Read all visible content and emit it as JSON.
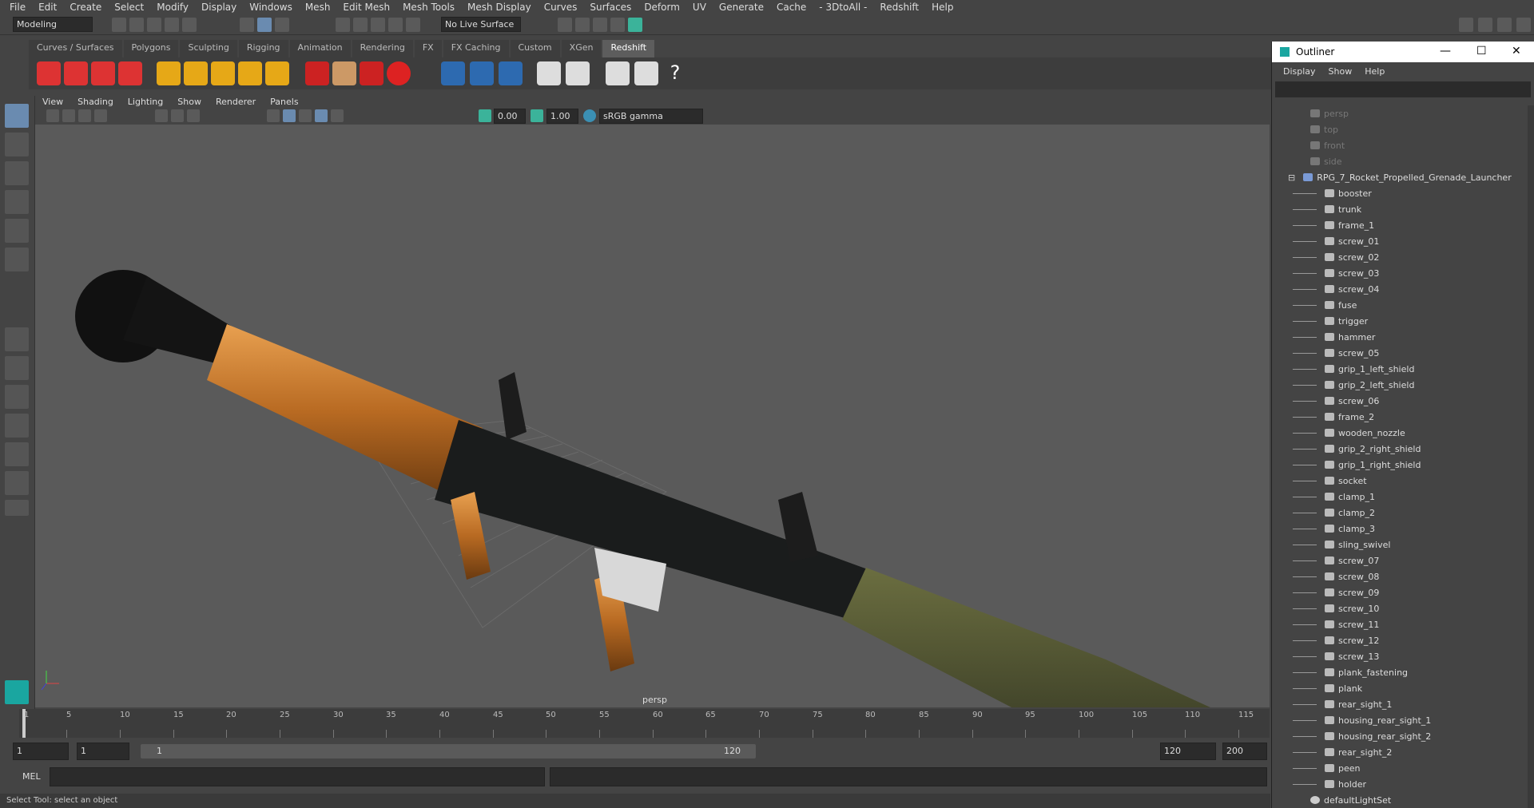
{
  "menubar": [
    "File",
    "Edit",
    "Create",
    "Select",
    "Modify",
    "Display",
    "Windows",
    "Mesh",
    "Edit Mesh",
    "Mesh Tools",
    "Mesh Display",
    "Curves",
    "Surfaces",
    "Deform",
    "UV",
    "Generate",
    "Cache",
    "- 3DtoAll -",
    "Redshift",
    "Help"
  ],
  "status": {
    "mode": "Modeling",
    "live_surface": "No Live Surface"
  },
  "shelf_tabs": [
    "Curves / Surfaces",
    "Polygons",
    "Sculpting",
    "Rigging",
    "Animation",
    "Rendering",
    "FX",
    "FX Caching",
    "Custom",
    "XGen",
    "Redshift"
  ],
  "shelf_active": "Redshift",
  "shelf_icon_labels": [
    "RV",
    "",
    "IPR",
    "",
    "PR",
    "PR",
    "PR",
    "LOG",
    "?"
  ],
  "viewport_menu": [
    "View",
    "Shading",
    "Lighting",
    "Show",
    "Renderer",
    "Panels"
  ],
  "vp_toolbar": {
    "exposure": "0.00",
    "gamma": "1.00",
    "colorspace": "sRGB gamma"
  },
  "viewport": {
    "camera_label": "persp"
  },
  "timeline": {
    "ticks": [
      "1",
      "5",
      "10",
      "15",
      "20",
      "25",
      "30",
      "35",
      "40",
      "45",
      "50",
      "55",
      "60",
      "65",
      "70",
      "75",
      "80",
      "85",
      "90",
      "95",
      "100",
      "105",
      "110",
      "115"
    ]
  },
  "range": {
    "start": "1",
    "current": "1",
    "slider_start": "1",
    "slider_end": "120",
    "end": "120",
    "max": "200"
  },
  "cmdline": {
    "label": "MEL"
  },
  "help": "Select Tool: select an object",
  "outliner": {
    "title": "Outliner",
    "menu": [
      "Display",
      "Show",
      "Help"
    ],
    "cameras": [
      "persp",
      "top",
      "front",
      "side"
    ],
    "group": "RPG_7_Rocket_Propelled_Grenade_Launcher",
    "children": [
      "booster",
      "trunk",
      "frame_1",
      "screw_01",
      "screw_02",
      "screw_03",
      "screw_04",
      "fuse",
      "trigger",
      "hammer",
      "screw_05",
      "grip_1_left_shield",
      "grip_2_left_shield",
      "screw_06",
      "frame_2",
      "wooden_nozzle",
      "grip_2_right_shield",
      "grip_1_right_shield",
      "socket",
      "clamp_1",
      "clamp_2",
      "clamp_3",
      "sling_swivel",
      "screw_07",
      "screw_08",
      "screw_09",
      "screw_10",
      "screw_11",
      "screw_12",
      "screw_13",
      "plank_fastening",
      "plank",
      "rear_sight_1",
      "housing_rear_sight_1",
      "housing_rear_sight_2",
      "rear_sight_2",
      "peen",
      "holder"
    ],
    "set": "defaultLightSet"
  }
}
